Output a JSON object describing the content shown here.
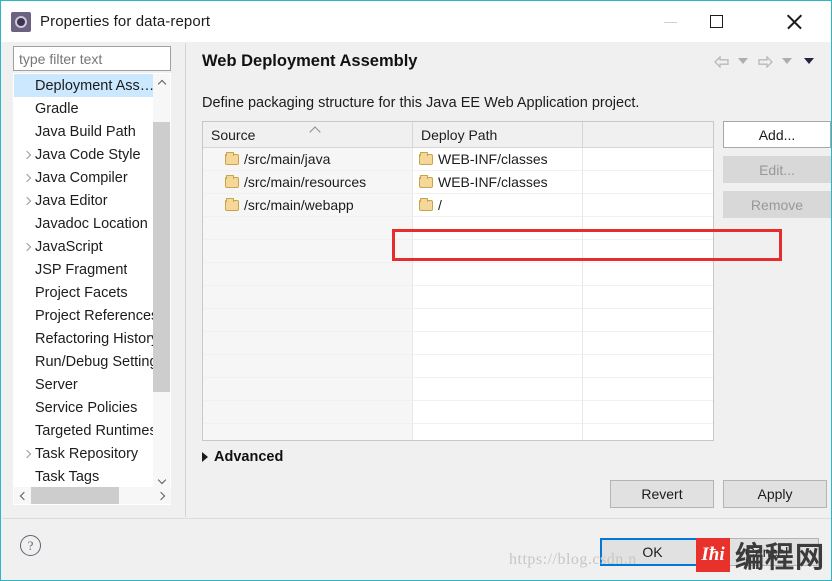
{
  "window": {
    "title": "Properties for data-report",
    "icon": "eclipse-gear-icon",
    "minimize_label": "Minimize",
    "maximize_label": "Maximize",
    "close_label": "Close"
  },
  "sidebar": {
    "filter": {
      "value": "",
      "placeholder": "type filter text"
    },
    "items": [
      {
        "label": "Deployment Ass…",
        "expandable": false,
        "selected": true
      },
      {
        "label": "Gradle",
        "expandable": false,
        "selected": false
      },
      {
        "label": "Java Build Path",
        "expandable": false,
        "selected": false
      },
      {
        "label": "Java Code Style",
        "expandable": true,
        "selected": false
      },
      {
        "label": "Java Compiler",
        "expandable": true,
        "selected": false
      },
      {
        "label": "Java Editor",
        "expandable": true,
        "selected": false
      },
      {
        "label": "Javadoc Location",
        "expandable": false,
        "selected": false
      },
      {
        "label": "JavaScript",
        "expandable": true,
        "selected": false
      },
      {
        "label": "JSP Fragment",
        "expandable": false,
        "selected": false
      },
      {
        "label": "Project Facets",
        "expandable": false,
        "selected": false
      },
      {
        "label": "Project References",
        "expandable": false,
        "selected": false
      },
      {
        "label": "Refactoring History",
        "expandable": false,
        "selected": false
      },
      {
        "label": "Run/Debug Settings",
        "expandable": false,
        "selected": false
      },
      {
        "label": "Server",
        "expandable": false,
        "selected": false
      },
      {
        "label": "Service Policies",
        "expandable": false,
        "selected": false
      },
      {
        "label": "Targeted Runtimes",
        "expandable": false,
        "selected": false
      },
      {
        "label": "Task Repository",
        "expandable": true,
        "selected": false
      },
      {
        "label": "Task Tags",
        "expandable": false,
        "selected": false
      }
    ]
  },
  "content": {
    "title": "Web Deployment Assembly",
    "description": "Define packaging structure for this Java EE Web Application project.",
    "nav": {
      "back_label": "Back",
      "back_menu_label": "Back history",
      "forward_label": "Forward",
      "forward_menu_label": "Forward history",
      "view_menu_label": "View menu"
    },
    "table": {
      "columns": [
        "Source",
        "Deploy Path",
        ""
      ],
      "sort_column": "Source",
      "sort_direction": "ascending",
      "rows": [
        {
          "source": "/src/main/java",
          "deploy_path": "WEB-INF/classes",
          "extra": "",
          "highlighted": false
        },
        {
          "source": "/src/main/resources",
          "deploy_path": "WEB-INF/classes",
          "extra": "",
          "highlighted": false
        },
        {
          "source": "/src/main/webapp",
          "deploy_path": "/",
          "extra": "",
          "highlighted": true
        }
      ],
      "empty_row_count": 11
    },
    "side_buttons": [
      {
        "label": "Add...",
        "enabled": true
      },
      {
        "label": "Edit...",
        "enabled": false
      },
      {
        "label": "Remove",
        "enabled": false
      }
    ],
    "advanced": {
      "label": "Advanced",
      "expanded": false
    },
    "revert_label": "Revert",
    "apply_label": "Apply"
  },
  "footer": {
    "help_label": "?",
    "ok_label": "OK",
    "cancel_label": "Cancel"
  },
  "watermark": {
    "url": "https://blog.csdn.n",
    "logo_text": "Iħi",
    "brand": "编程网"
  },
  "colors": {
    "window_border": "#31b3c4",
    "selection": "#cce8ff",
    "highlight_box": "#e62d2d",
    "focus_border": "#0078d7",
    "folder": "#f5d899",
    "brand_red": "#e8312a"
  }
}
